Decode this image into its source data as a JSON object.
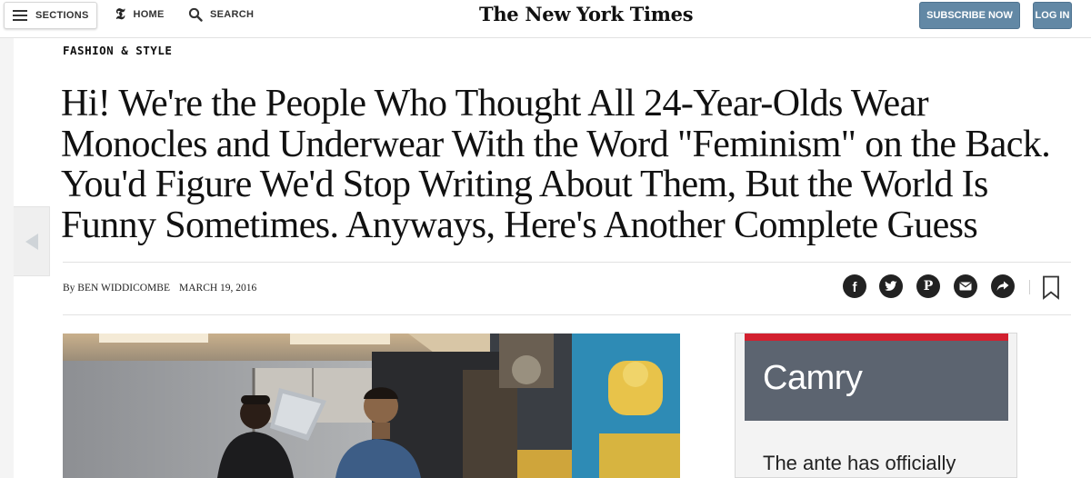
{
  "nav": {
    "sections_label": "SECTIONS",
    "home_label": "HOME",
    "search_label": "SEARCH",
    "masthead": "The New York Times",
    "subscribe_label": "SUBSCRIBE NOW",
    "login_label": "LOG IN"
  },
  "article": {
    "section": "FASHION & STYLE",
    "headline": "Hi! We're the People Who Thought All 24-Year-Olds Wear Monocles and Underwear With the Word \"Feminism\" on the Back. You'd Figure We'd Stop Writing About Them, But the World Is Funny Sometimes. Anyways, Here's Another Complete Guess",
    "byline": "By BEN WIDDICOMBE",
    "date": "MARCH 19, 2016"
  },
  "share": {
    "icons": [
      "facebook-icon",
      "twitter-icon",
      "pinterest-icon",
      "email-icon",
      "share-icon",
      "bookmark-icon"
    ],
    "glyphs": {
      "facebook": "f",
      "pinterest": "P"
    }
  },
  "ad": {
    "title": "Camry",
    "text": "The ante has officially",
    "accent": "#d2202f",
    "panel_color": "#5c6470"
  },
  "colors": {
    "button_blue": "#6288a5",
    "text": "#111111",
    "rule": "#e2e2e2"
  }
}
